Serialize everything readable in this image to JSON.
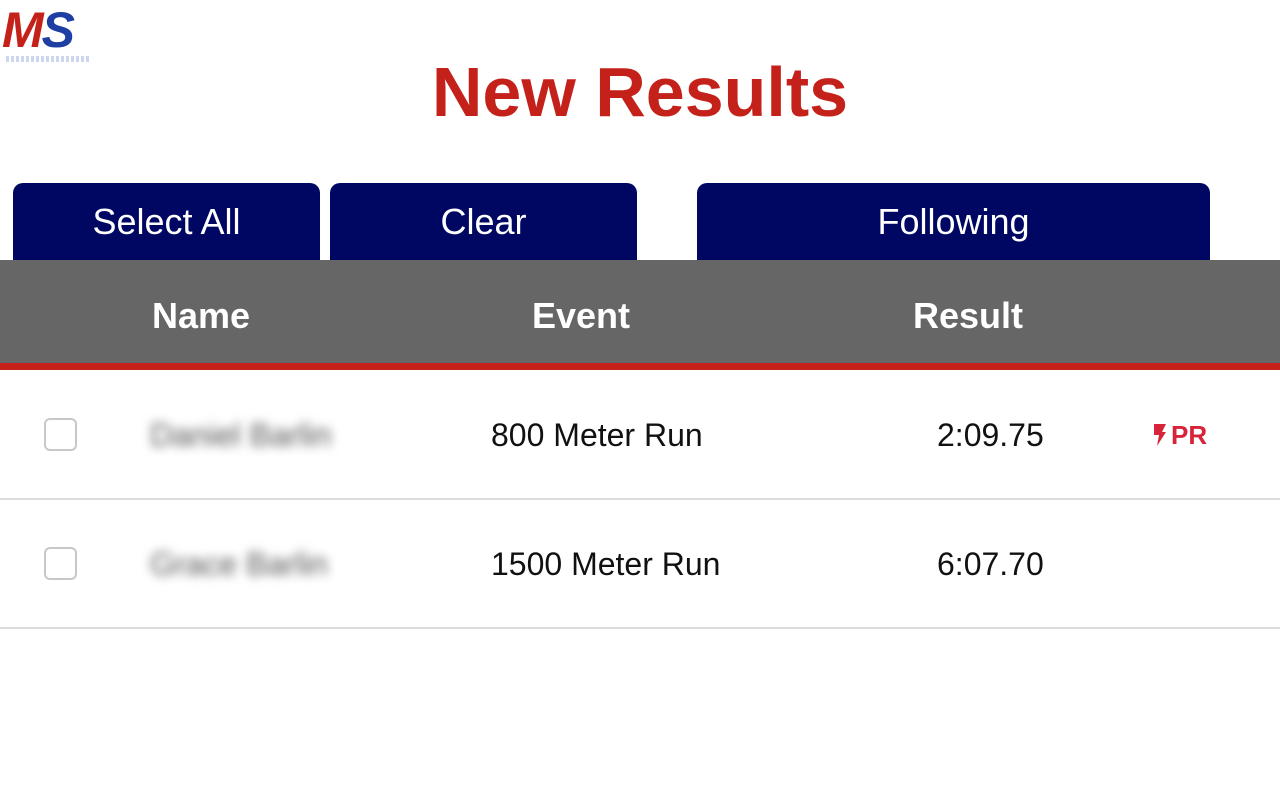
{
  "logo": {
    "text_m": "M",
    "text_s": "S",
    "brand_colors": {
      "red": "#c4211b",
      "blue": "#1f3ea3"
    }
  },
  "page": {
    "title": "New Results",
    "accent_color": "#c4211b"
  },
  "toolbar": {
    "select_all_label": "Select All",
    "clear_label": "Clear",
    "following_label": "Following",
    "button_color": "#000763"
  },
  "table": {
    "header": {
      "name": "Name",
      "event": "Event",
      "result": "Result",
      "background": "#666666",
      "underline_color": "#c4211b"
    },
    "rows": [
      {
        "checked": false,
        "name": "Daniel Barlin",
        "name_blurred": true,
        "event": "800 Meter Run",
        "result": "2:09.75",
        "badge": "PR",
        "badge_icon": "lightning-bolt-icon",
        "badge_color": "#d8243a"
      },
      {
        "checked": false,
        "name": "Grace Barlin",
        "name_blurred": true,
        "event": "1500 Meter Run",
        "result": "6:07.70",
        "badge": ""
      }
    ]
  }
}
